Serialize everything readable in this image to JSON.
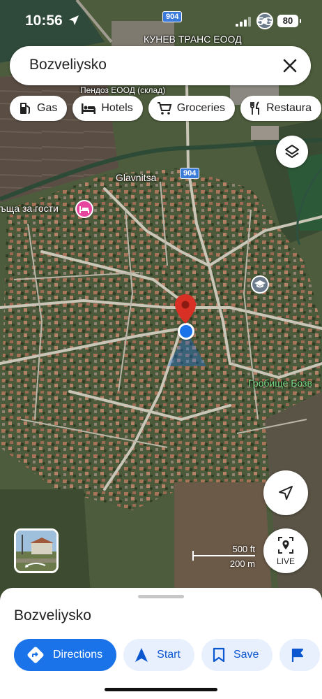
{
  "status_bar": {
    "time": "10:56",
    "network": "5G",
    "battery": "80"
  },
  "search": {
    "query": "Bozveliysko"
  },
  "chips": [
    {
      "label": "Gas",
      "icon": "gas-station-icon"
    },
    {
      "label": "Hotels",
      "icon": "bed-icon"
    },
    {
      "label": "Groceries",
      "icon": "cart-icon"
    },
    {
      "label": "Restaura",
      "icon": "fork-knife-icon"
    }
  ],
  "map": {
    "labels": {
      "company_top": "КУНЕВ ТРАНС ЕООД",
      "warehouse": "Пендоз ЕООД (склад)",
      "village": "Glavnitsa",
      "guesthouse": "ъща за гости",
      "cemetery": "Гробище Бозв"
    },
    "road_number": "904",
    "road_number_2": "904",
    "scale_feet": "500 ft",
    "scale_meters": "200 m"
  },
  "controls": {
    "live_label": "LIVE"
  },
  "sheet": {
    "place_name": "Bozveliysko",
    "actions": {
      "directions": "Directions",
      "start": "Start",
      "save": "Save"
    }
  },
  "colors": {
    "accent": "#1a73e8",
    "pin": "#d93025",
    "hotel_poi": "#e8469e",
    "school_poi": "#6b7b8c",
    "chip_bg": "#ffffff"
  }
}
